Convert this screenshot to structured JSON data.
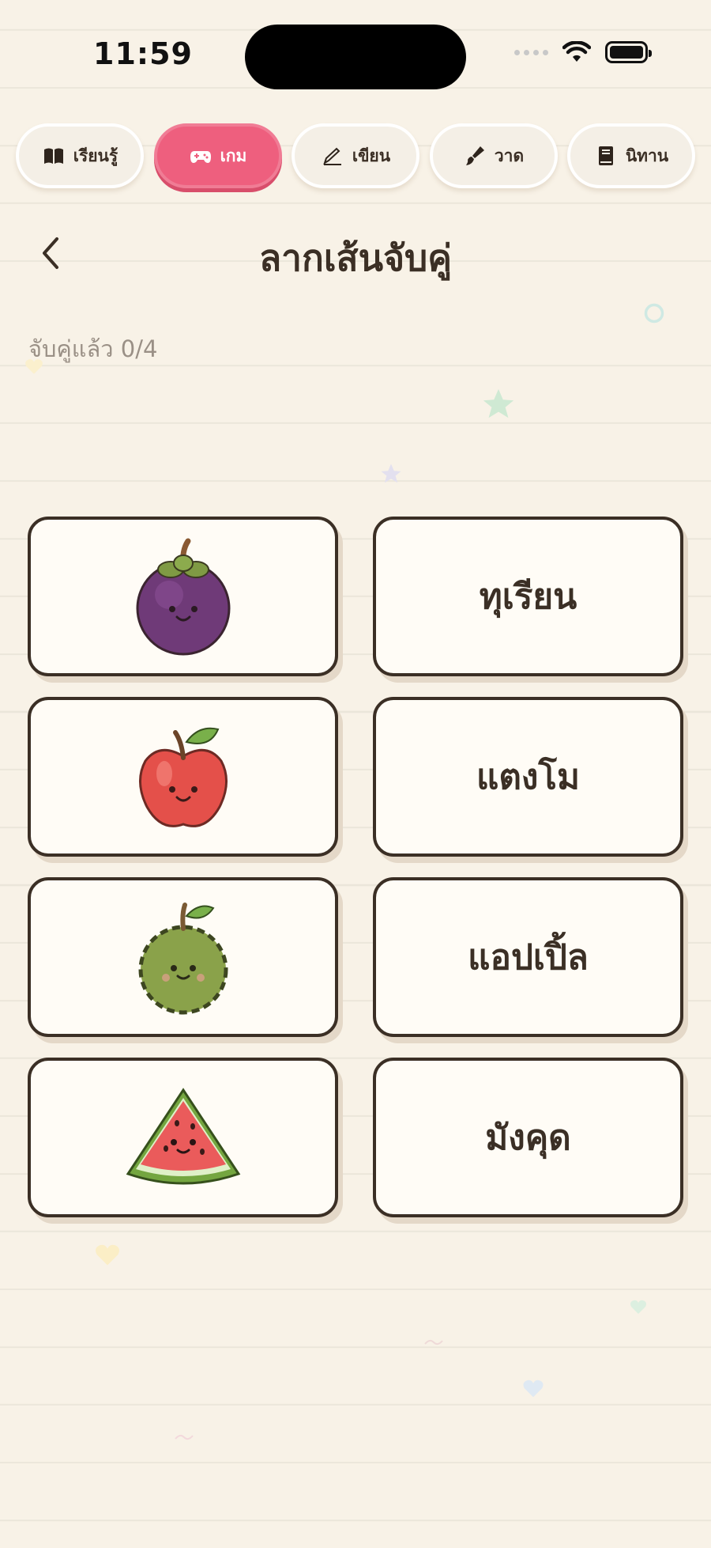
{
  "status_bar": {
    "time": "11:59"
  },
  "tabs": [
    {
      "label": "เรียนรู้",
      "icon": "book-open-icon",
      "active": false
    },
    {
      "label": "เกม",
      "icon": "gamepad-icon",
      "active": true
    },
    {
      "label": "เขียน",
      "icon": "pencil-icon",
      "active": false
    },
    {
      "label": "วาด",
      "icon": "paintbrush-icon",
      "active": false
    },
    {
      "label": "นิทาน",
      "icon": "book-icon",
      "active": false
    }
  ],
  "header": {
    "title": "ลากเส้นจับคู่"
  },
  "progress": {
    "text": "จับคู่แล้ว 0/4",
    "matched": 0,
    "total": 4
  },
  "pictures": [
    {
      "fruit": "mangosteen-icon"
    },
    {
      "fruit": "apple-icon"
    },
    {
      "fruit": "durian-icon"
    },
    {
      "fruit": "watermelon-icon"
    }
  ],
  "words": [
    "ทุเรียน",
    "แตงโม",
    "แอปเปิ้ล",
    "มังคุด"
  ],
  "colors": {
    "background": "#f8f2e7",
    "accent": "#ee5f7e",
    "text": "#3b2f25",
    "card": "#fffcf6"
  }
}
